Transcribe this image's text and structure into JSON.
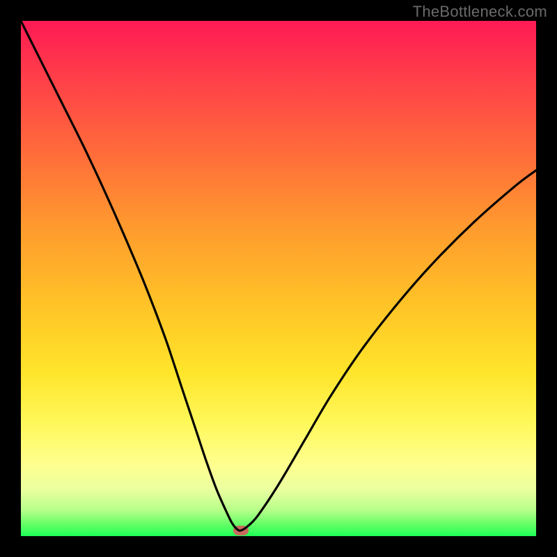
{
  "watermark": "TheBottleneck.com",
  "chart_data": {
    "type": "line",
    "title": "",
    "xlabel": "",
    "ylabel": "",
    "xlim": [
      0,
      100
    ],
    "ylim": [
      0,
      100
    ],
    "grid": false,
    "series": [
      {
        "name": "bottleneck-curve",
        "x": [
          0,
          4,
          8,
          12,
          16,
          20,
          24,
          28,
          31,
          34,
          36,
          38,
          40,
          41,
          42,
          42.7,
          44,
          46,
          50,
          55,
          60,
          66,
          73,
          80,
          88,
          96,
          100
        ],
        "y": [
          100,
          92,
          84,
          76,
          67.5,
          58.5,
          49,
          38.5,
          29.5,
          20.5,
          14.5,
          9,
          4.5,
          2.5,
          1.3,
          1.1,
          1.9,
          4,
          10,
          18.5,
          27,
          36,
          45,
          53,
          61,
          68,
          71
        ],
        "color": "#000000"
      }
    ],
    "background_gradient_stops": [
      {
        "pos": 0.0,
        "hex": "#ff1a55"
      },
      {
        "pos": 0.1,
        "hex": "#ff3b4a"
      },
      {
        "pos": 0.25,
        "hex": "#ff6a3b"
      },
      {
        "pos": 0.4,
        "hex": "#ff9a2e"
      },
      {
        "pos": 0.55,
        "hex": "#ffc327"
      },
      {
        "pos": 0.68,
        "hex": "#ffe42a"
      },
      {
        "pos": 0.78,
        "hex": "#fff85a"
      },
      {
        "pos": 0.86,
        "hex": "#ffff8e"
      },
      {
        "pos": 0.91,
        "hex": "#eaffa0"
      },
      {
        "pos": 0.95,
        "hex": "#b6ff8a"
      },
      {
        "pos": 0.98,
        "hex": "#5cff63"
      },
      {
        "pos": 1.0,
        "hex": "#1eff57"
      }
    ],
    "marker": {
      "x": 42.7,
      "y": 1.1,
      "color": "#c96a5e"
    }
  }
}
